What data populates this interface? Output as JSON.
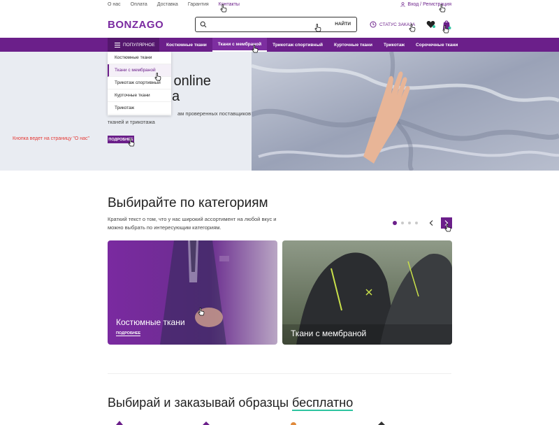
{
  "topbar": {
    "links": [
      "О нас",
      "Оплата",
      "Доставка",
      "Гарантия",
      "Контакты"
    ],
    "login": "Вход / Регистрация"
  },
  "header": {
    "logo": "BONZAGO",
    "search_placeholder": "",
    "search_button": "НАЙТИ",
    "order_status": "СТАТУС ЗАКАЗА"
  },
  "nav": {
    "popular": "ПОПУЛЯРНОЕ",
    "items": [
      "Костюмные ткани",
      "Ткани с мембраной",
      "Трикотаж спортивный",
      "Курточные ткани",
      "Трикотаж",
      "Сорочечные ткани"
    ]
  },
  "dropdown": {
    "items": [
      "Костюмные ткани",
      "Ткани с мембраной",
      "Трикотаж спортивный",
      "Курточные ткани",
      "Трикотаж"
    ]
  },
  "hero": {
    "title_line1": "ная online",
    "title_line2": "а",
    "desc_line1": "ам проверенных поставщиков",
    "desc_line2": "тканей и трикотажа",
    "note": "Кнопка ведет на страницу \"О нас\"",
    "button": "ПОДРОБНЕЕ"
  },
  "categories": {
    "title": "Выбирайте по категориям",
    "desc": "Краткий текст о том, что у нас широкий ассортимент на любой вкус и можно выбрать по интересующим категориям.",
    "cards": [
      {
        "label": "Костюмные ткани",
        "more": "ПОДРОБНЕЕ"
      },
      {
        "label": "Ткани с мембраной"
      }
    ]
  },
  "samples": {
    "title_start": "Выбирай и заказывай образцы ",
    "title_highlight": "бесплатно"
  },
  "colors": {
    "brand": "#6b1f8a",
    "brand_dark": "#54176d",
    "note": "#e53935",
    "accent_underline": "#2ec4a0"
  }
}
